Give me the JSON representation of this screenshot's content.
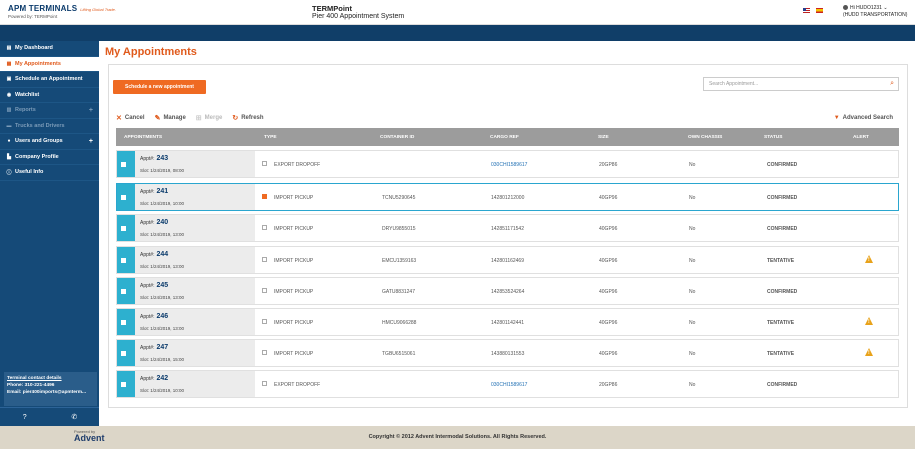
{
  "header": {
    "logo_main": "APM TERMINALS",
    "logo_tagline": "Lifting Global Trade.",
    "logo_sub": "Powered by: TERMPoint",
    "app_title": "TERMPoint",
    "app_subtitle": "Pier 400 Appointment System",
    "user_greeting": "Hi HUDO1231",
    "user_company": "(HUDD TRANSPORTATION)",
    "user_menu_icon": "chevron-down-icon"
  },
  "sidebar": {
    "items": [
      {
        "label": "My Dashboard",
        "icon": "dashboard-icon"
      },
      {
        "label": "My Appointments",
        "icon": "calendar-icon"
      },
      {
        "label": "Schedule an Appointment",
        "icon": "schedule-icon"
      },
      {
        "label": "Watchlist",
        "icon": "eye-icon"
      },
      {
        "label": "Reports",
        "icon": "reports-icon"
      },
      {
        "label": "Trucks and Drivers",
        "icon": "truck-icon"
      },
      {
        "label": "Users and Groups",
        "icon": "users-icon"
      },
      {
        "label": "Company Profile",
        "icon": "building-icon"
      },
      {
        "label": "Useful Info",
        "icon": "info-icon"
      }
    ],
    "contact_title": "Terminal contact details",
    "contact_phone": "Phone: 310-221-4496",
    "contact_email": "Email: pier400imports@apmterm...",
    "footer_help_icon": "help-icon",
    "footer_phone_icon": "phone-icon"
  },
  "main": {
    "page_title": "My Appointments",
    "schedule_button": "Schedule a new appointment",
    "search_placeholder": "Search Appointment...",
    "toolbar": {
      "cancel": "Cancel",
      "manage": "Manage",
      "merge": "Merge",
      "refresh": "Refresh",
      "advanced_search": "Advanced Search"
    },
    "columns": [
      "APPOINTMENTS",
      "TYPE",
      "CONTAINER ID",
      "CARGO REF",
      "SIZE",
      "OWN CHASSIS",
      "STATUS",
      "ALERT"
    ],
    "rows": [
      {
        "appt_prefix": "Appt#:",
        "appt_no": "243",
        "slot": "Slot: 1/24/2019, 08:00",
        "type": "EXPORT DROPOFF",
        "container": "",
        "cargo": "030CHI1589617",
        "cargo_link": true,
        "size": "20GP86",
        "chassis": "No",
        "status": "CONFIRMED",
        "alert": false,
        "checked": false
      },
      {
        "appt_prefix": "Appt#:",
        "appt_no": "241",
        "slot": "Slot: 1/24/2019, 10:00",
        "type": "IMPORT PICKUP",
        "container": "TCNU5290645",
        "cargo": "142801212000",
        "cargo_link": false,
        "size": "40GP96",
        "chassis": "No",
        "status": "CONFIRMED",
        "alert": false,
        "checked": true
      },
      {
        "appt_prefix": "Appt#:",
        "appt_no": "240",
        "slot": "Slot: 1/24/2019, 13:00",
        "type": "IMPORT PICKUP",
        "container": "DRYU9855015",
        "cargo": "142851171542",
        "cargo_link": false,
        "size": "40GP96",
        "chassis": "No",
        "status": "CONFIRMED",
        "alert": false,
        "checked": false
      },
      {
        "appt_prefix": "Appt#:",
        "appt_no": "244",
        "slot": "Slot: 1/24/2019, 13:00",
        "type": "IMPORT PICKUP",
        "container": "EMCU1359163",
        "cargo": "142801162469",
        "cargo_link": false,
        "size": "40GP96",
        "chassis": "No",
        "status": "TENTATIVE",
        "alert": true,
        "checked": false
      },
      {
        "appt_prefix": "Appt#:",
        "appt_no": "245",
        "slot": "Slot: 1/24/2019, 13:00",
        "type": "IMPORT PICKUP",
        "container": "GATU8831247",
        "cargo": "142853524264",
        "cargo_link": false,
        "size": "40GP96",
        "chassis": "No",
        "status": "CONFIRMED",
        "alert": false,
        "checked": false
      },
      {
        "appt_prefix": "Appt#:",
        "appt_no": "246",
        "slot": "Slot: 1/24/2019, 13:00",
        "type": "IMPORT PICKUP",
        "container": "HMCU9066288",
        "cargo": "142801142441",
        "cargo_link": false,
        "size": "40GP96",
        "chassis": "No",
        "status": "TENTATIVE",
        "alert": true,
        "checked": false
      },
      {
        "appt_prefix": "Appt#:",
        "appt_no": "247",
        "slot": "Slot: 1/24/2019, 15:00",
        "type": "IMPORT PICKUP",
        "container": "TGBU6515061",
        "cargo": "143880131553",
        "cargo_link": false,
        "size": "40GP96",
        "chassis": "No",
        "status": "TENTATIVE",
        "alert": true,
        "checked": false
      },
      {
        "appt_prefix": "Appt#:",
        "appt_no": "242",
        "slot": "Slot: 1/24/2019, 10:00",
        "type": "EXPORT DROPOFF",
        "container": "",
        "cargo": "030CHI1589617",
        "cargo_link": true,
        "size": "20GP86",
        "chassis": "No",
        "status": "CONFIRMED",
        "alert": false,
        "checked": false
      }
    ]
  },
  "footer": {
    "powered_by": "Powered by",
    "advent": "Advent",
    "copyright": "Copyright © 2012 Advent Intermodal Solutions. All Rights Reserved."
  },
  "colors": {
    "brand_orange": "#e05a1c",
    "navy": "#154a78",
    "teal": "#2db0cf",
    "confirmed": "#4a6d1f",
    "tentative": "#1f6fb3",
    "alert": "#e8a21a"
  }
}
